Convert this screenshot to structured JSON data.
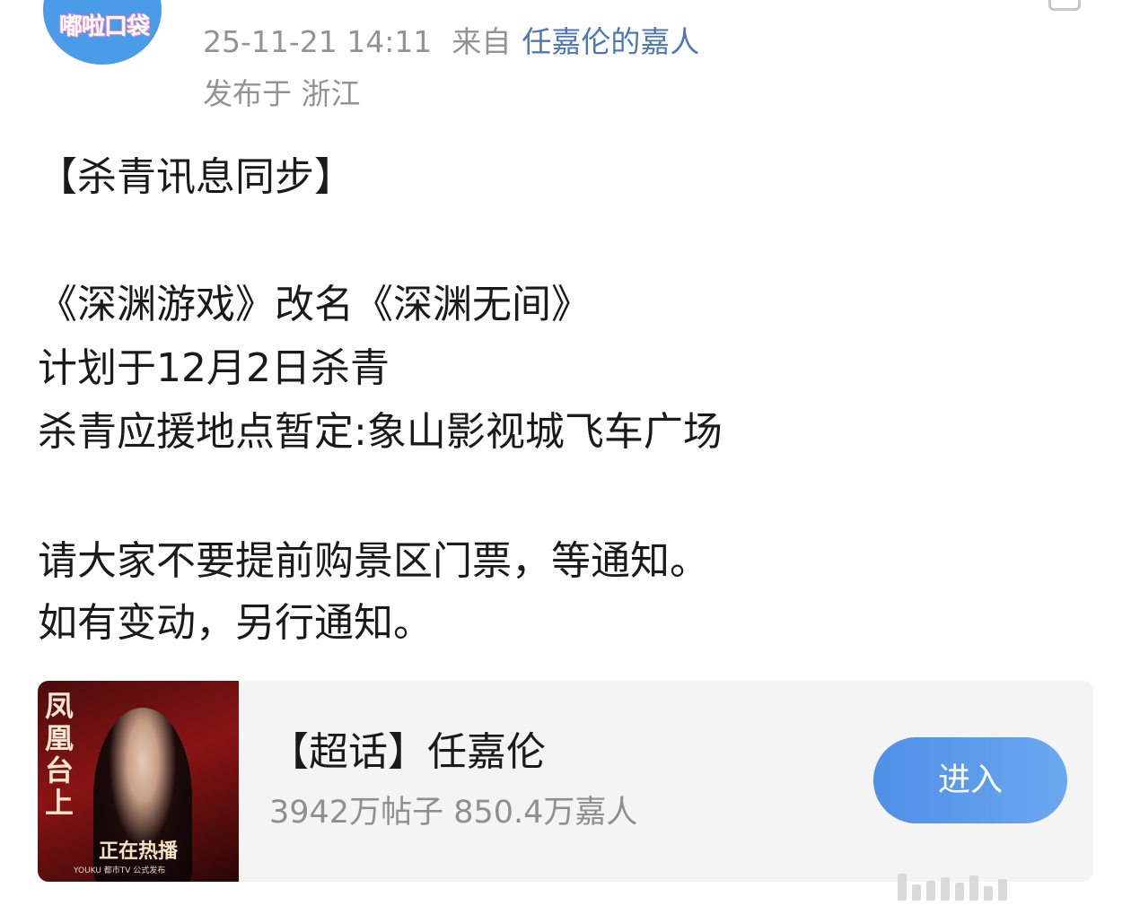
{
  "avatar": {
    "text": "嘟啦口袋"
  },
  "meta": {
    "timestamp": "25-11-21 14:11",
    "source_prefix": "来自",
    "source_name": "任嘉伦的嘉人",
    "location": "发布于 浙江"
  },
  "post": {
    "lines": [
      "【杀青讯息同步】",
      "《深渊游戏》改名《深渊无间》",
      "计划于12月2日杀青",
      "杀青应援地点暂定:象山影视城飞车广场",
      "请大家不要提前购景区门票，等通知。",
      "如有变动，另行通知。"
    ]
  },
  "topic_card": {
    "poster_title": "凤凰台上",
    "poster_subtitle": "正在热播",
    "poster_logos": "YOUKU 都市TV 公式发布",
    "title": "【超话】任嘉伦",
    "stats": "3942万帖子 850.4万嘉人",
    "enter_label": "进入"
  },
  "colors": {
    "link": "#4d78b5",
    "meta_text": "#939393",
    "button": "#5b9bec",
    "card_bg": "#f4f4f5"
  }
}
